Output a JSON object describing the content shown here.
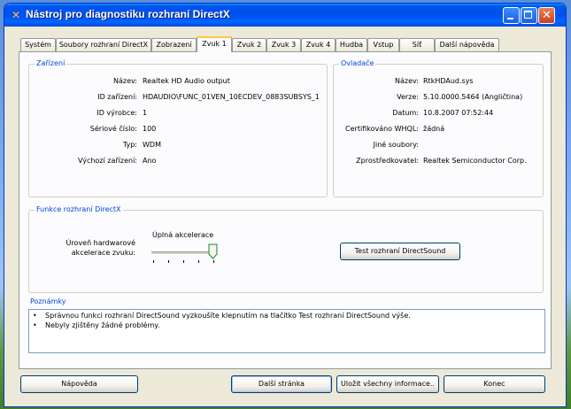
{
  "window": {
    "title": "Nástroj pro diagnostiku rozhraní DirectX"
  },
  "tabs": [
    "Systém",
    "Soubory rozhraní DirectX",
    "Zobrazení",
    "Zvuk 1",
    "Zvuk 2",
    "Zvuk 3",
    "Zvuk 4",
    "Hudba",
    "Vstup",
    "Síť",
    "Další nápověda"
  ],
  "active_tab": "Zvuk 1",
  "device": {
    "title": "Zařízení",
    "fields": [
      {
        "label": "Název:",
        "value": "Realtek HD Audio output"
      },
      {
        "label": "ID zařízení:",
        "value": "HDAUDIO\\FUNC_01VEN_10ECDEV_0883SUBSYS_1"
      },
      {
        "label": "ID výrobce:",
        "value": "1"
      },
      {
        "label": "Sériové číslo:",
        "value": "100"
      },
      {
        "label": "Typ:",
        "value": "WDM"
      },
      {
        "label": "Výchozí zařízení:",
        "value": "Ano"
      }
    ]
  },
  "driver": {
    "title": "Ovladače",
    "fields": [
      {
        "label": "Název:",
        "value": "RtkHDAud.sys"
      },
      {
        "label": "Verze:",
        "value": "5.10.0000.5464 (Angličtina)"
      },
      {
        "label": "Datum:",
        "value": "10.8.2007 07:52:44"
      },
      {
        "label": "Certifikováno WHQL:",
        "value": "žádná"
      },
      {
        "label": "Jiné soubory:",
        "value": ""
      },
      {
        "label": "Zprostředkovatel:",
        "value": "Realtek Semiconductor Corp."
      }
    ]
  },
  "features": {
    "title": "Funkce rozhraní DirectX",
    "accel_label_line1": "Úroveň hardwarové",
    "accel_label_line2": "akcelerace zvuku:",
    "slider_value_label": "Úplná akcelerace",
    "slider_level": 1.0,
    "test_button": "Test rozhraní DirectSound"
  },
  "notes": {
    "title": "Poznámky",
    "items": [
      "Správnou funkci rozhraní DirectSound vyzkoušíte klepnutím na tlačítko Test rozhraní DirectSound výše.",
      "Nebyly zjištěny žádné problémy."
    ]
  },
  "buttons": {
    "help": "Nápověda",
    "next": "Další stránka",
    "save": "Uložit všechny informace..",
    "exit": "Konec"
  }
}
